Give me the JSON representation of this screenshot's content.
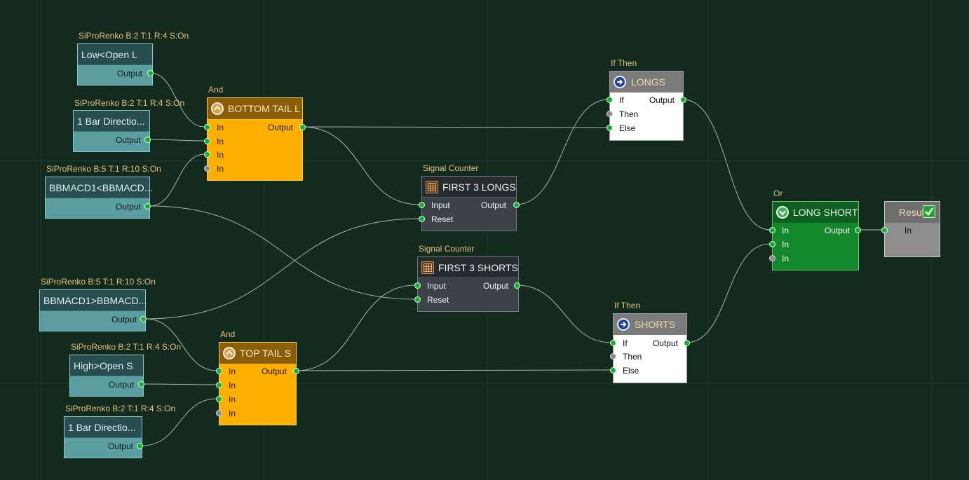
{
  "colors": {
    "background": "#132a1f",
    "wire": "#a9b5ae",
    "port_active": "#14b030",
    "port_inactive": "#8a8a8a",
    "indicator": "#5a9ea2",
    "and_block": "#fdb000",
    "counter": "#3c4348",
    "if_then": "#ffffff",
    "or_block": "#14862c",
    "result": "#8e8e8e"
  },
  "nodes": {
    "ind1": {
      "caption": "SiProRenko B:2 T:1 R:4 S:On",
      "title": "Low<Open L",
      "output": "Output"
    },
    "ind2": {
      "caption": "SiProRenko B:2 T:1 R:4 S:On",
      "title": "1 Bar Directio...",
      "output": "Output"
    },
    "ind3": {
      "caption": "SiProRenko B:5 T:1 R:10 S:On",
      "title": "BBMACD1<BBMACD...",
      "output": "Output"
    },
    "ind4": {
      "caption": "SiProRenko B:5 T:1 R:10 S:On",
      "title": "BBMACD1>BBMACD...",
      "output": "Output"
    },
    "ind5": {
      "caption": "SiProRenko B:2 T:1 R:4 S:On",
      "title": "High>Open S",
      "output": "Output"
    },
    "ind6": {
      "caption": "SiProRenko B:2 T:1 R:4 S:On",
      "title": "1 Bar Directio...",
      "output": "Output"
    },
    "and1": {
      "caption": "And",
      "title": "BOTTOM TAIL L",
      "inputs": [
        "In",
        "In",
        "In",
        "In"
      ],
      "output": "Output",
      "icon": "chevron-up-icon"
    },
    "and2": {
      "caption": "And",
      "title": "TOP TAIL S",
      "inputs": [
        "In",
        "In",
        "In",
        "In"
      ],
      "output": "Output",
      "icon": "chevron-up-icon"
    },
    "cnt1": {
      "caption": "Signal Counter",
      "title": "FIRST 3 LONGS",
      "inputs": [
        "Input",
        "Reset"
      ],
      "output": "Output",
      "icon": "grid-counter-icon"
    },
    "cnt2": {
      "caption": "Signal Counter",
      "title": "FIRST 3 SHORTS",
      "inputs": [
        "Input",
        "Reset"
      ],
      "output": "Output",
      "icon": "grid-counter-icon"
    },
    "if1": {
      "caption": "If Then",
      "title": "LONGS",
      "inputs": [
        "If",
        "Then",
        "Else"
      ],
      "output": "Output",
      "icon": "arrow-right-icon"
    },
    "if2": {
      "caption": "If Then",
      "title": "SHORTS",
      "inputs": [
        "If",
        "Then",
        "Else"
      ],
      "output": "Output",
      "icon": "arrow-right-icon"
    },
    "or1": {
      "caption": "Or",
      "title": "LONG SHORT",
      "inputs": [
        "In",
        "In",
        "In"
      ],
      "output": "Output",
      "icon": "chevron-down-icon"
    },
    "result": {
      "title": "Result",
      "input": "In",
      "icon": "checkmark-icon"
    }
  }
}
